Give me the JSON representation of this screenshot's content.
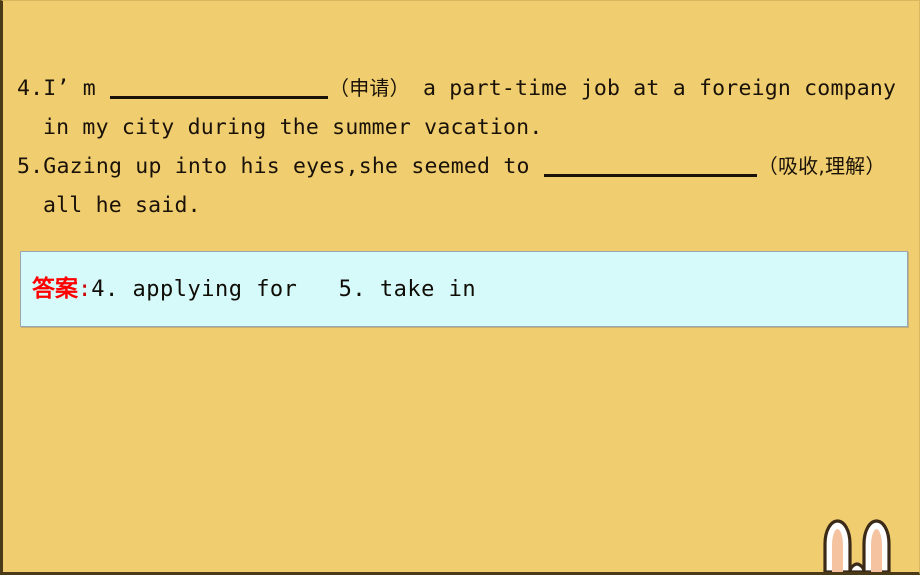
{
  "slide": {
    "background_color": "#f0ce70",
    "border_color": "#4a3a18"
  },
  "questions": [
    {
      "number": "4.",
      "line1_before": "I’ m ",
      "blank": "__________________",
      "hint": "（申请）",
      "line1_after": " a part-time job at a foreign company",
      "line2": "in my city during the summer vacation."
    },
    {
      "number": "5.",
      "line1_before": "Gazing up into his eyes,she seemed to ",
      "blank": "__________________",
      "hint": "（吸收,理解）",
      "line1_after": "",
      "line2": "all he said."
    }
  ],
  "answer": {
    "label": "答案",
    "colon": ":",
    "text": "4. applying for   5. take in",
    "label_color": "#ff0000",
    "box_background": "#d6fafa",
    "box_border": "#9aa6b0"
  },
  "decoration": {
    "name": "rabbit-ears",
    "ear_fill": "#ffffff",
    "ear_inner": "#f5c3a0",
    "ear_outline": "#3b2a18"
  }
}
